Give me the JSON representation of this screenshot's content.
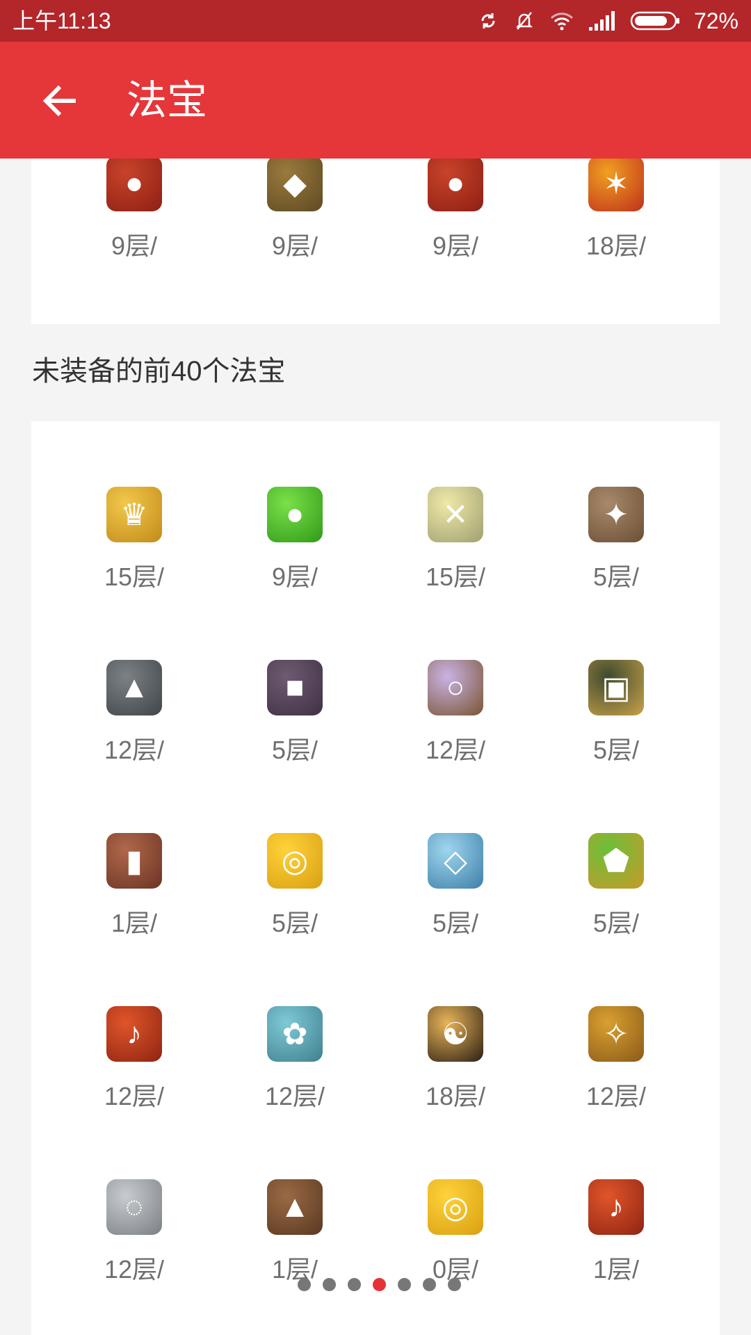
{
  "status_bar": {
    "time": "上午11:13",
    "battery": "72%",
    "icons": [
      "sync-icon",
      "muted-bell-icon",
      "wifi-icon",
      "signal-icon",
      "battery-icon"
    ]
  },
  "app_bar": {
    "title": "法宝",
    "back_icon": "arrow-left-icon"
  },
  "equipped": {
    "items": [
      {
        "label": "9层/",
        "icon": "red-drum"
      },
      {
        "label": "9层/",
        "icon": "bronze-pouch"
      },
      {
        "label": "9层/",
        "icon": "red-drum"
      },
      {
        "label": "18层/",
        "icon": "flame-drum"
      }
    ]
  },
  "unequipped": {
    "title": "未装备的前40个法宝",
    "items": [
      {
        "label": "15层/",
        "icon": "golden-crown"
      },
      {
        "label": "9层/",
        "icon": "green-gourd"
      },
      {
        "label": "15层/",
        "icon": "paper-doll"
      },
      {
        "label": "5层/",
        "icon": "voodoo-doll"
      },
      {
        "label": "12层/",
        "icon": "stone-lantern"
      },
      {
        "label": "5层/",
        "icon": "purple-box"
      },
      {
        "label": "12层/",
        "icon": "hand-mirror"
      },
      {
        "label": "5层/",
        "icon": "treasure-chest"
      },
      {
        "label": "1层/",
        "icon": "hanging-banner"
      },
      {
        "label": "5层/",
        "icon": "golden-rope"
      },
      {
        "label": "5层/",
        "icon": "jade-flute"
      },
      {
        "label": "5层/",
        "icon": "dragon-pendant"
      },
      {
        "label": "12层/",
        "icon": "red-bell"
      },
      {
        "label": "12层/",
        "icon": "jade-figure"
      },
      {
        "label": "18层/",
        "icon": "yin-yang-scroll"
      },
      {
        "label": "12层/",
        "icon": "feather-fan"
      },
      {
        "label": "12层/",
        "icon": "prayer-beads"
      },
      {
        "label": "1层/",
        "icon": "wooden-seal"
      },
      {
        "label": "0层/",
        "icon": "golden-rope"
      },
      {
        "label": "1层/",
        "icon": "red-bell"
      }
    ]
  },
  "pager": {
    "count": 7,
    "active": 3
  },
  "colors": {
    "status_bar": "#b3262a",
    "app_bar": "#e5363a",
    "background": "#f4f4f4",
    "active_dot": "#e53238"
  }
}
